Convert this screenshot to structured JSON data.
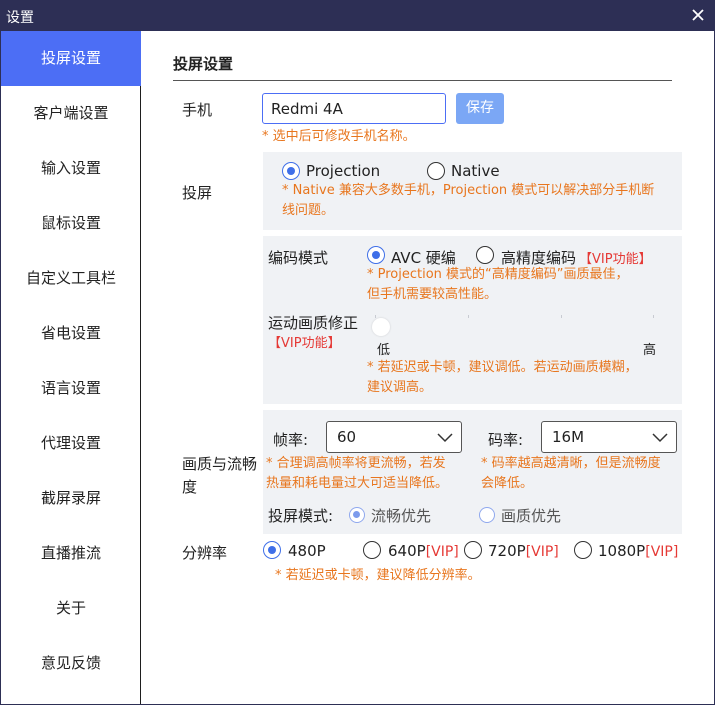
{
  "window": {
    "title": "设置"
  },
  "sidebar": {
    "items": [
      {
        "label": "投屏设置"
      },
      {
        "label": "客户端设置"
      },
      {
        "label": "输入设置"
      },
      {
        "label": "鼠标设置"
      },
      {
        "label": "自定义工具栏"
      },
      {
        "label": "省电设置"
      },
      {
        "label": "语言设置"
      },
      {
        "label": "代理设置"
      },
      {
        "label": "截屏录屏"
      },
      {
        "label": "直播推流"
      },
      {
        "label": "关于"
      },
      {
        "label": "意见反馈"
      }
    ],
    "active_index": 0
  },
  "main": {
    "title": "投屏设置",
    "phone": {
      "label": "手机",
      "value": "Redmi 4A",
      "save_label": "保存",
      "hint": "* 选中后可修改手机名称。"
    },
    "cast": {
      "label": "投屏",
      "options": [
        {
          "label": "Projection",
          "checked": true
        },
        {
          "label": "Native",
          "checked": false
        }
      ],
      "hint_line1": "* Native 兼容大多数手机，Projection 模式可以解决部分手机断",
      "hint_line2": "线问题。"
    },
    "encoding": {
      "label": "编码模式",
      "options": [
        {
          "label": "AVC 硬编",
          "checked": true
        },
        {
          "label": "高精度编码",
          "checked": false
        }
      ],
      "vip": "【VIP功能】",
      "hint_line1": "* Projection 模式的“高精度编码”画质最佳，",
      "hint_line2": "但手机需要较高性能。"
    },
    "motion": {
      "label": "运动画质修正",
      "vip": "【VIP功能】",
      "low": "低",
      "high": "高",
      "value": 0,
      "hint_line1": "* 若延迟或卡顿，建议调低。若运动画质模糊，",
      "hint_line2": "建议调高。"
    },
    "quality": {
      "label_line1": "画质与流畅",
      "label_line2": "度",
      "fps_label": "帧率:",
      "fps_value": "60",
      "fps_hint_line1": "* 合理调高帧率将更流畅，若发",
      "fps_hint_line2": "热量和耗电量过大可适当降低。",
      "bitrate_label": "码率:",
      "bitrate_value": "16M",
      "bitrate_hint_line1": "* 码率越高越清晰，但是流畅度",
      "bitrate_hint_line2": "会降低。",
      "mode_label": "投屏模式:",
      "mode_options": [
        {
          "label": "流畅优先",
          "checked": true
        },
        {
          "label": "画质优先",
          "checked": false
        }
      ]
    },
    "resolution": {
      "label": "分辨率",
      "options": [
        {
          "label": "480P",
          "vip": "",
          "checked": true
        },
        {
          "label": "640P",
          "vip": "[VIP]",
          "checked": false
        },
        {
          "label": "720P",
          "vip": "[VIP]",
          "checked": false
        },
        {
          "label": "1080P",
          "vip": "[VIP]",
          "checked": false
        }
      ],
      "hint": "* 若延迟或卡顿，建议降低分辨率。"
    }
  },
  "colors": {
    "titlebar": "#2d2f55",
    "accent": "#4c6ef5",
    "hint": "#e8761e",
    "vip": "#e53935",
    "panel": "#f0f2f5"
  }
}
